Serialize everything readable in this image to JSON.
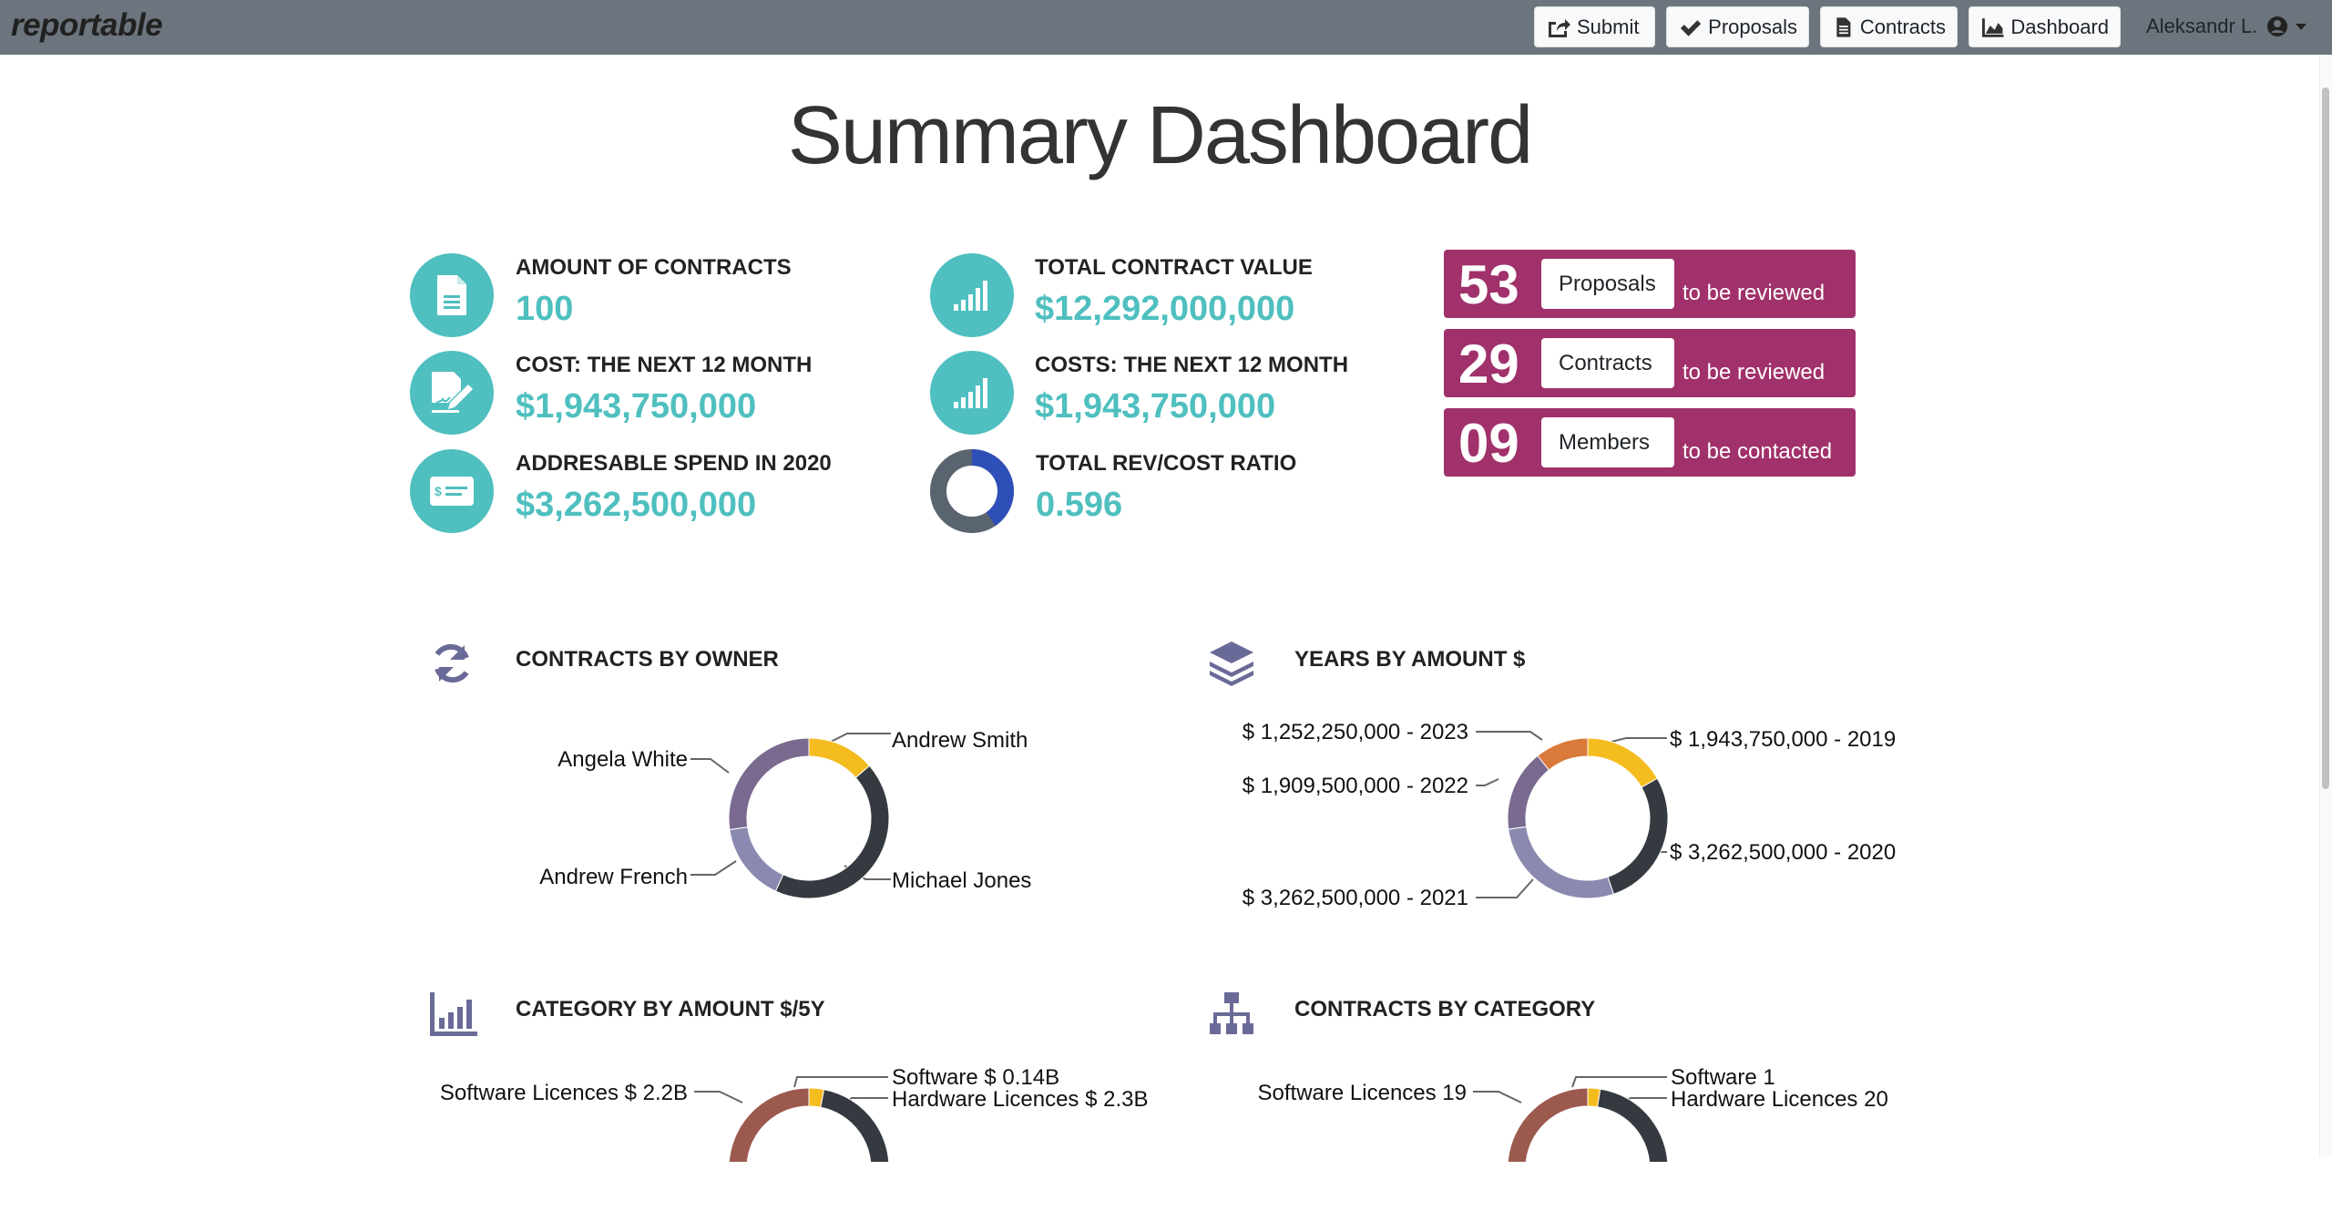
{
  "nav": {
    "brand": "reportable",
    "buttons": [
      {
        "label": "Submit",
        "icon": "share-icon"
      },
      {
        "label": "Proposals",
        "icon": "check-icon"
      },
      {
        "label": "Contracts",
        "icon": "file-icon"
      },
      {
        "label": "Dashboard",
        "icon": "area-chart-icon"
      }
    ],
    "user": "Aleksandr L."
  },
  "title": "Summary Dashboard",
  "stats": [
    {
      "label": "AMOUNT OF CONTRACTS",
      "value": "100",
      "icon": "document-icon"
    },
    {
      "label": "COST: THE NEXT 12 MONTH",
      "value": "$1,943,750,000",
      "icon": "signed-contract-icon"
    },
    {
      "label": "ADDRESABLE SPEND IN 2020",
      "value": "$3,262,500,000",
      "icon": "check-payment-icon"
    },
    {
      "label": "TOTAL CONTRACT VALUE",
      "value": "$12,292,000,000",
      "icon": "signal-bars-icon"
    },
    {
      "label": "COSTS: THE NEXT 12 MONTH",
      "value": "$1,943,750,000",
      "icon": "signal-bars-icon"
    },
    {
      "label": "TOTAL REV/COST RATIO",
      "value": "0.596",
      "icon": "ratio-donut-icon",
      "ratio": 0.596
    }
  ],
  "reviews": [
    {
      "count": "53",
      "badge": "Proposals",
      "desc": "to be reviewed"
    },
    {
      "count": "29",
      "badge": "Contracts",
      "desc": "to be reviewed"
    },
    {
      "count": "09",
      "badge": "Members",
      "desc": "to be contacted"
    }
  ],
  "colors": {
    "teal": "#4fbfbf",
    "magenta": "#a0316a",
    "navbar": "#6c757d",
    "yellow": "#f5bc1f",
    "dark": "#343a40",
    "lavender": "#8a89b0",
    "purple": "#7a6a90",
    "orange": "#d97a3a",
    "brown": "#9c5a4f",
    "blue": "#2f4fb8"
  },
  "sections": {
    "owner_title": "CONTRACTS BY OWNER",
    "years_title": "YEARS BY AMOUNT $",
    "category_amount_title": "CATEGORY BY AMOUNT $/5Y",
    "contracts_category_title": "CONTRACTS BY CATEGORY"
  },
  "chart_data": [
    {
      "type": "pie",
      "title": "CONTRACTS BY OWNER",
      "labels": [
        "Andrew Smith",
        "Michael Jones",
        "Andrew French",
        "Angela White"
      ],
      "values": [
        12,
        38,
        14,
        24
      ],
      "colors": [
        "#f5bc1f",
        "#343a40",
        "#8a89b0",
        "#7a6a90"
      ]
    },
    {
      "type": "pie",
      "title": "YEARS BY AMOUNT $",
      "labels": [
        "$ 1,943,750,000 - 2019",
        "$ 3,262,500,000 - 2020",
        "$ 3,262,500,000 - 2021",
        "$ 1,909,500,000 - 2022",
        "$ 1,252,250,000 - 2023"
      ],
      "values": [
        1943750000,
        3262500000,
        3262500000,
        1909500000,
        1252250000
      ],
      "colors": [
        "#f5bc1f",
        "#343a40",
        "#8a89b0",
        "#7a6a90",
        "#d97a3a"
      ]
    },
    {
      "type": "pie",
      "title": "CATEGORY BY AMOUNT $/5Y",
      "labels": [
        "Software $ 0.14B",
        "Hardware Licences $ 2.3B",
        "Software Licences $ 2.2B"
      ],
      "values": [
        0.14,
        2.3,
        2.2
      ],
      "colors": [
        "#f5bc1f",
        "#343a40",
        "#9c5a4f"
      ]
    },
    {
      "type": "pie",
      "title": "CONTRACTS BY CATEGORY",
      "labels": [
        "Software 1",
        "Hardware Licences 20",
        "Software Licences 19"
      ],
      "values": [
        1,
        20,
        19
      ],
      "colors": [
        "#f5bc1f",
        "#343a40",
        "#9c5a4f"
      ]
    }
  ]
}
